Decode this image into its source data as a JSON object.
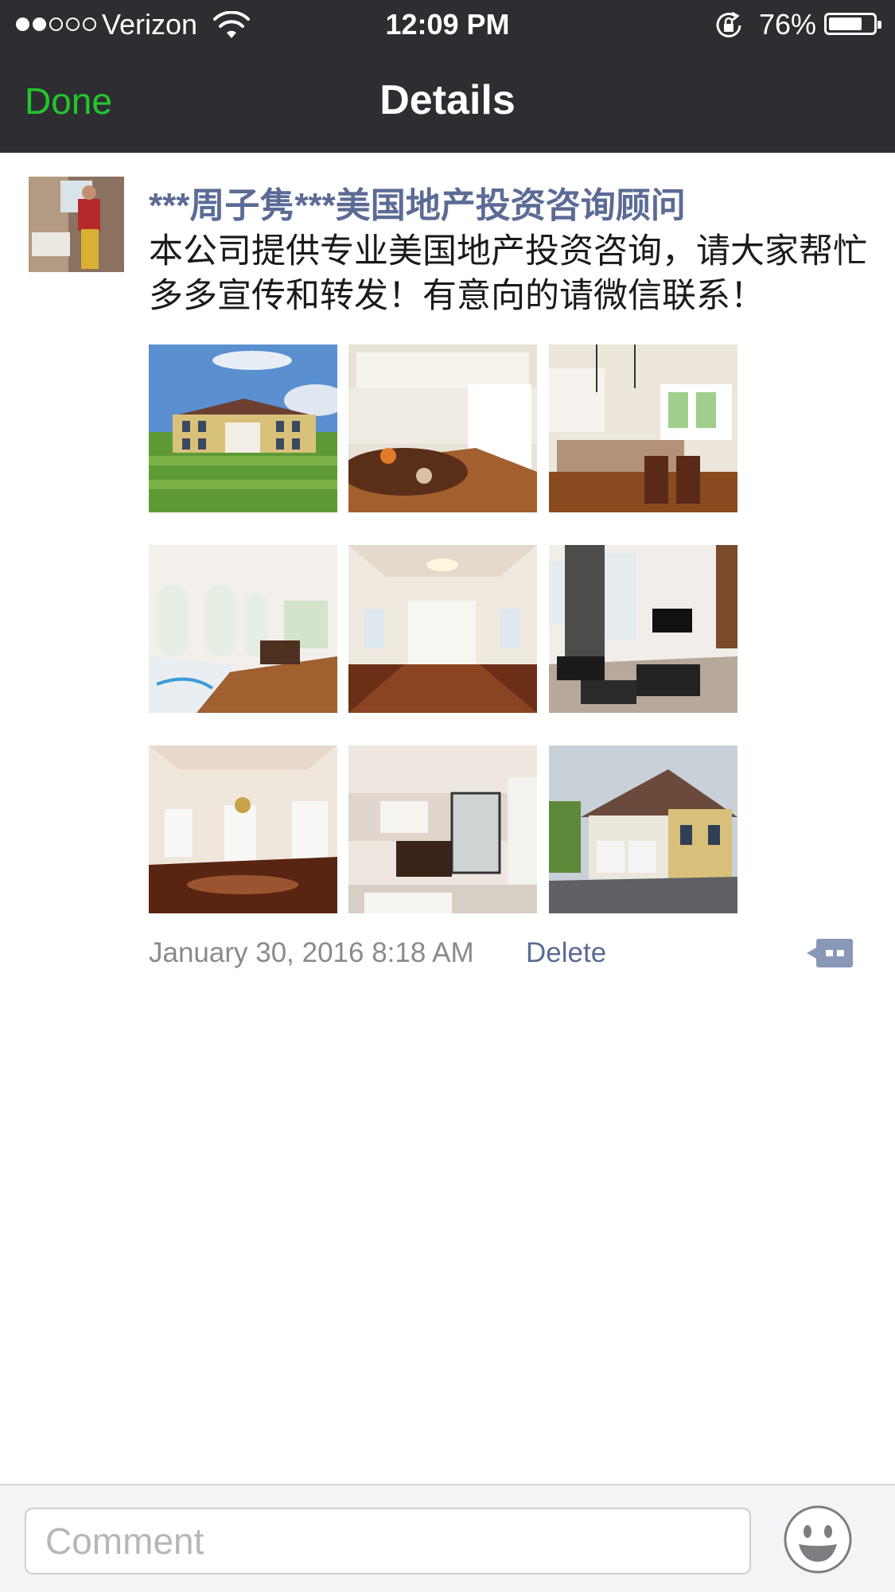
{
  "status_bar": {
    "carrier": "Verizon",
    "signal_strength": 2,
    "signal_max": 5,
    "time": "12:09 PM",
    "battery_percent": "76%",
    "battery_level": 0.76
  },
  "nav": {
    "done_label": "Done",
    "title": "Details"
  },
  "post": {
    "author": "***周子隽***美国地产投资咨询顾问",
    "text": "本公司提供专业美国地产投资咨询，请大家帮忙多多宣传和转发！有意向的请微信联系！",
    "photo_count": 9,
    "timestamp": "January 30, 2016 8:18 AM",
    "delete_label": "Delete"
  },
  "comment_bar": {
    "placeholder": "Comment"
  },
  "colors": {
    "accent_green": "#22c72c",
    "link_blue": "#5b6b95",
    "bar_dark": "#2e2e32"
  }
}
